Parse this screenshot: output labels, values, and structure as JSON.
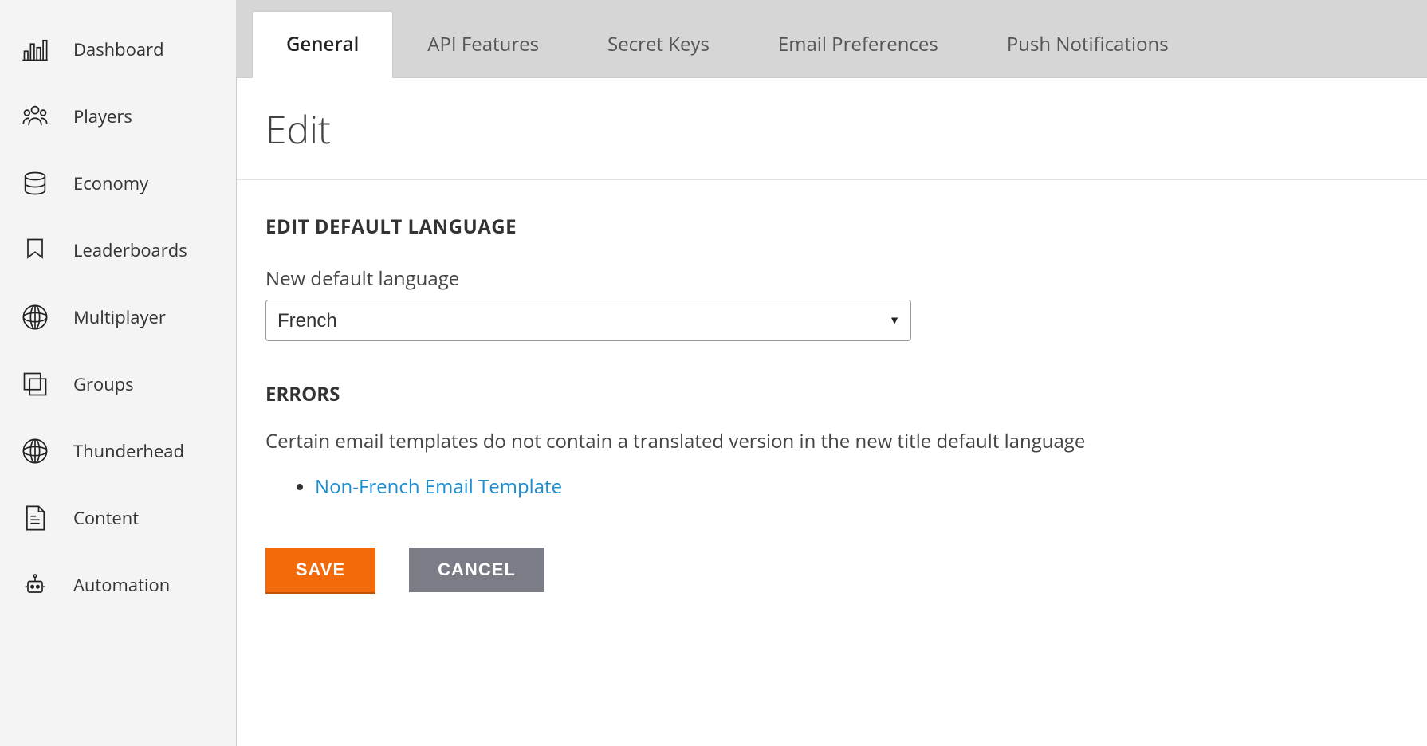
{
  "sidebar": {
    "items": [
      {
        "label": "Dashboard",
        "icon": "dashboard-icon"
      },
      {
        "label": "Players",
        "icon": "players-icon"
      },
      {
        "label": "Economy",
        "icon": "economy-icon"
      },
      {
        "label": "Leaderboards",
        "icon": "leaderboards-icon"
      },
      {
        "label": "Multiplayer",
        "icon": "multiplayer-icon"
      },
      {
        "label": "Groups",
        "icon": "groups-icon"
      },
      {
        "label": "Thunderhead",
        "icon": "thunderhead-icon"
      },
      {
        "label": "Content",
        "icon": "content-icon"
      },
      {
        "label": "Automation",
        "icon": "automation-icon"
      }
    ]
  },
  "tabs": [
    {
      "label": "General",
      "active": true
    },
    {
      "label": "API Features",
      "active": false
    },
    {
      "label": "Secret Keys",
      "active": false
    },
    {
      "label": "Email Preferences",
      "active": false
    },
    {
      "label": "Push Notifications",
      "active": false
    }
  ],
  "page": {
    "title": "Edit",
    "section_heading": "EDIT DEFAULT LANGUAGE",
    "field_label": "New default language",
    "language_selected": "French",
    "errors_heading": "ERRORS",
    "errors_text": "Certain email templates do not contain a translated version in the new title default language",
    "error_items": [
      {
        "label": "Non-French Email Template"
      }
    ],
    "save_label": "SAVE",
    "cancel_label": "CANCEL"
  }
}
